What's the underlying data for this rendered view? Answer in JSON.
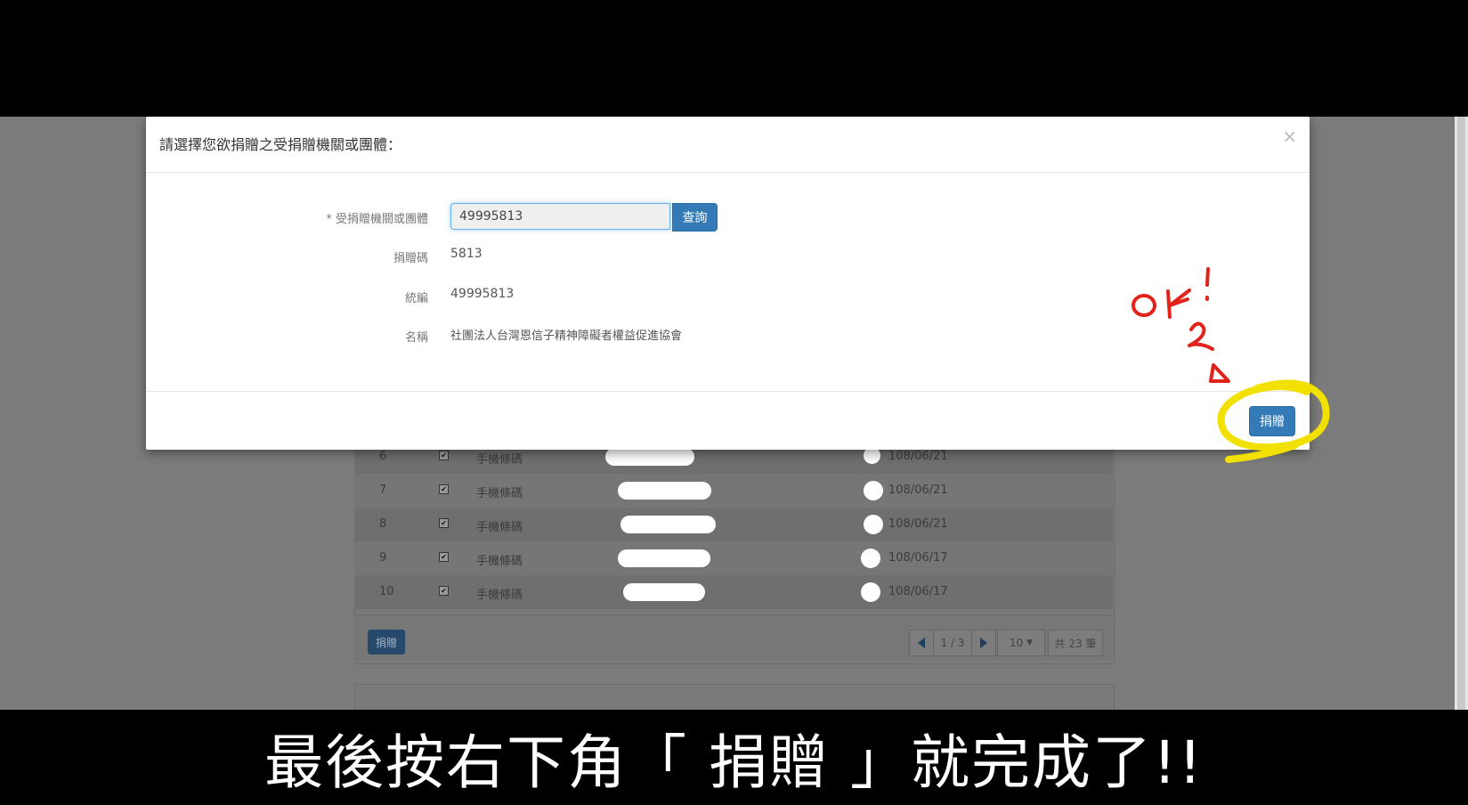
{
  "modal": {
    "title": "請選擇您欲捐贈之受捐贈機關或團體：",
    "close_glyph": "×",
    "fields": {
      "org_label": "* 受捐贈機關或團體",
      "org_input_value": "49995813",
      "search_button": "查詢",
      "code_label": "捐贈碼",
      "code_value": "5813",
      "tax_id_label": "統編",
      "tax_id_value": "49995813",
      "name_label": "名稱",
      "name_value": "社團法人台灣恩信子精神障礙者權益促進協會"
    },
    "donate_button": "捐贈"
  },
  "background_table": {
    "rows": [
      {
        "index": "6",
        "checked": true,
        "type": "手機條碼",
        "date": "108/06/21"
      },
      {
        "index": "7",
        "checked": true,
        "type": "手機條碼",
        "date": "108/06/21"
      },
      {
        "index": "8",
        "checked": true,
        "type": "手機條碼",
        "date": "108/06/21"
      },
      {
        "index": "9",
        "checked": true,
        "type": "手機條碼",
        "date": "108/06/17"
      },
      {
        "index": "10",
        "checked": true,
        "type": "手機條碼",
        "date": "108/06/17"
      }
    ],
    "donate_button": "捐贈",
    "pagination": {
      "page_info": "1 / 3",
      "page_size": "10",
      "total": "共 23 筆"
    }
  },
  "annotation": {
    "handwritten_text": "OK! 2 Δ",
    "highlight_color": "#f2e100",
    "ink_color": "#e2231a"
  },
  "caption": "最後按右下角「 捐贈 」就完成了!!"
}
